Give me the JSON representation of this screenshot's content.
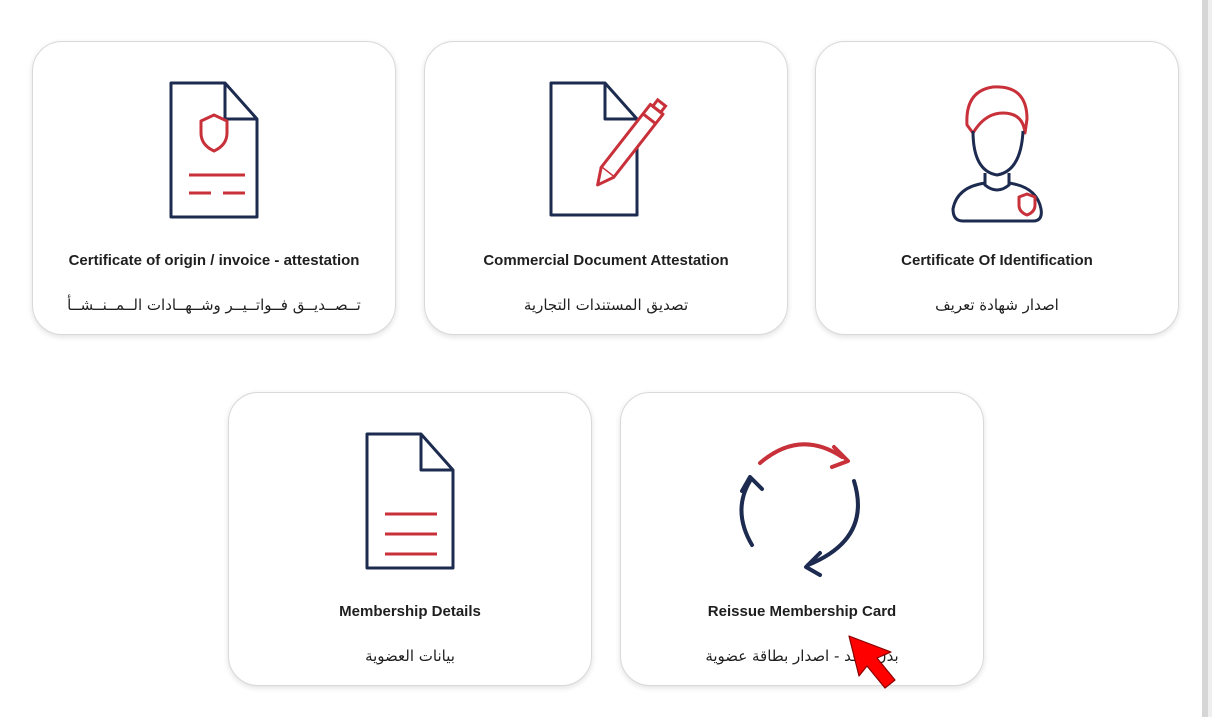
{
  "colors": {
    "navy": "#1c2b4f",
    "red": "#c8303a"
  },
  "cards": [
    {
      "title": "Certificate of origin / invoice - attestation",
      "subtitle": "تــصــديــق فــواتــيــر وشــهــادات الــمــنــشــأ",
      "icon": "document-shield-icon"
    },
    {
      "title": "Commercial Document Attestation",
      "subtitle": "تصديق المستندات التجارية",
      "icon": "document-pen-icon"
    },
    {
      "title": "Certificate Of Identification",
      "subtitle": "اصدار شهادة تعريف",
      "icon": "person-badge-icon"
    },
    {
      "title": "Membership Details",
      "subtitle": "بيانات العضوية",
      "icon": "document-lines-icon"
    },
    {
      "title": "Reissue Membership Card",
      "subtitle": "بدل فاقد - اصدار بطاقة عضوية",
      "icon": "refresh-cycle-icon"
    }
  ]
}
